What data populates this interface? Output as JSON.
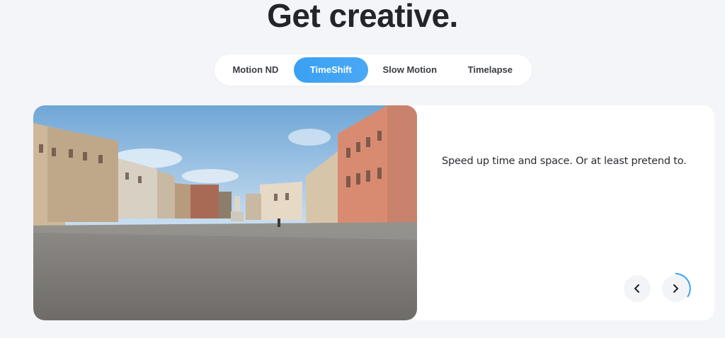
{
  "page": {
    "headline": "Get creative."
  },
  "tabs": [
    {
      "label": "Motion ND",
      "active": false
    },
    {
      "label": "TimeShift",
      "active": true
    },
    {
      "label": "Slow Motion",
      "active": false
    },
    {
      "label": "Timelapse",
      "active": false
    }
  ],
  "slide": {
    "caption": "Speed up time and space. Or at least pretend to.",
    "image_icon": "venice-piazza-photo"
  },
  "carousel": {
    "prev_icon": "chevron-left-icon",
    "next_icon": "chevron-right-icon"
  },
  "colors": {
    "accent": "#3aa0f3",
    "background": "#f4f5f9",
    "card": "#ffffff",
    "text": "#23252a"
  }
}
